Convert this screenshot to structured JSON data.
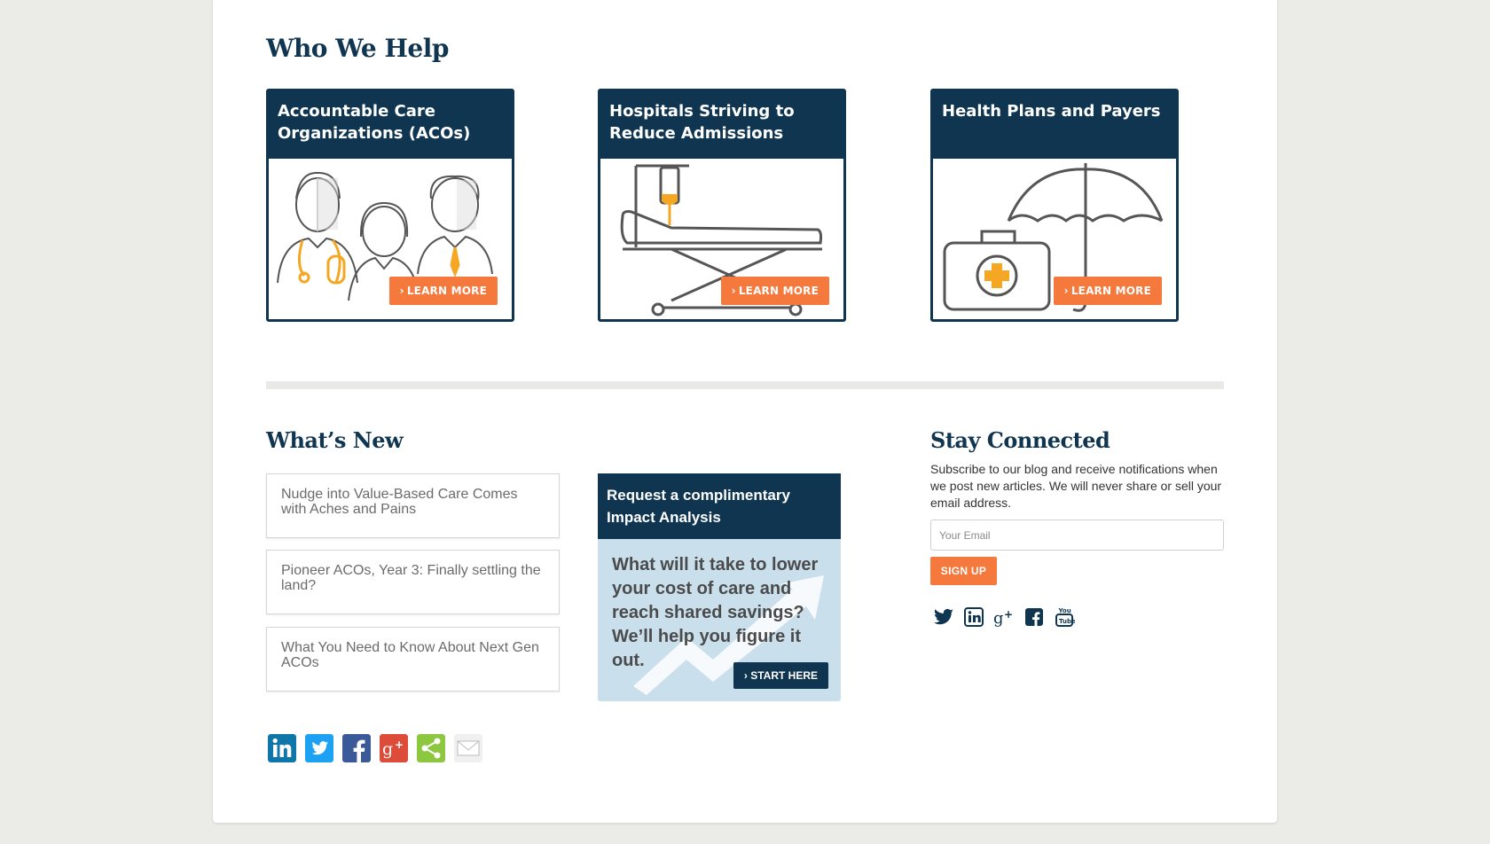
{
  "who_we_help": {
    "title": "Who We Help",
    "cards": [
      {
        "title": "Accountable Care Organizations (ACOs)",
        "button": "LEARN MORE"
      },
      {
        "title": "Hospitals Striving to Reduce Admissions",
        "button": "LEARN MORE"
      },
      {
        "title": "Health Plans and Payers",
        "button": "LEARN MORE"
      }
    ]
  },
  "whats_new": {
    "title": "What’s New",
    "items": [
      "Nudge into Value-Based Care Comes with Aches and Pains",
      "Pioneer ACOs, Year 3: Finally settling the land?",
      "What You Need to Know About Next Gen ACOs"
    ]
  },
  "promo": {
    "title": "Request a complimentary Impact Analysis",
    "body": "What will it take to lower your cost of care and reach shared savings? We’ll help you figure it out.",
    "button": "START HERE"
  },
  "stay_connected": {
    "title": "Stay Connected",
    "text": "Subscribe to our blog and receive notifications when we post new articles. We will never share or sell your email address.",
    "email_placeholder": "Your Email",
    "signup_label": "SIGN UP",
    "social_icons": [
      "twitter-icon",
      "linkedin-icon",
      "google-plus-icon",
      "facebook-icon",
      "youtube-icon"
    ]
  },
  "share_icons": [
    "linkedin-icon",
    "twitter-icon",
    "facebook-icon",
    "google-plus-icon",
    "share-icon",
    "email-icon"
  ],
  "colors": {
    "navy": "#0f3550",
    "orange": "#f5793d",
    "light_blue": "#c9dfeb"
  }
}
